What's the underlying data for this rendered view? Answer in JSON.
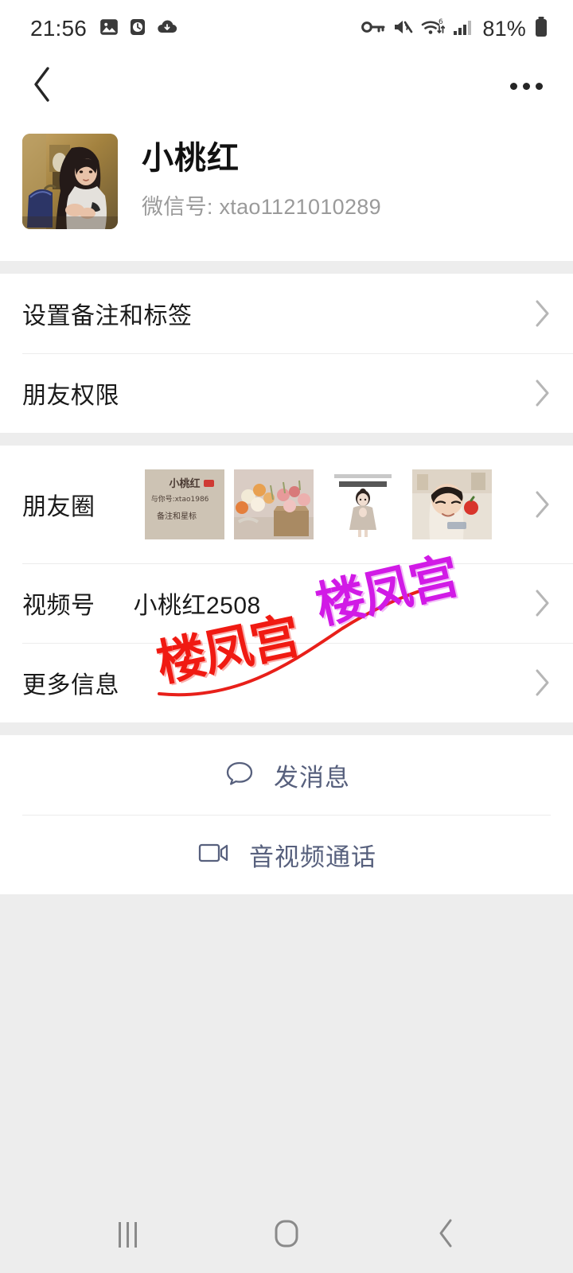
{
  "status_bar": {
    "time": "21:56",
    "battery_percent": "81%",
    "left_icons": [
      "image-icon",
      "clock-icon",
      "cloud-download-icon"
    ],
    "right_icons": [
      "vpn-key-icon",
      "mute-icon",
      "wifi-6-icon",
      "cellular-signal-icon",
      "battery-icon"
    ]
  },
  "nav_bar": {
    "back_icon": "chevron-left-icon",
    "more_icon": "more-options-icon",
    "title": ""
  },
  "profile": {
    "name": "小桃红",
    "wechat_id_label": "微信号:",
    "wechat_id": "xtao1121010289",
    "wechat_id_full": "微信号: xtao1121010289",
    "avatar_alt": "woman-portrait-avatar"
  },
  "settings_rows": [
    {
      "label": "设置备注和标签",
      "chevron": "chevron-right-icon"
    },
    {
      "label": "朋友权限",
      "chevron": "chevron-right-icon"
    }
  ],
  "info_rows": {
    "moments": {
      "label": "朋友圈",
      "chevron": "chevron-right-icon",
      "thumbnails": [
        {
          "alt": "profile-card-thumbnail",
          "caption_name": "小桃红",
          "caption_id": "与你号:xtao1986",
          "caption_note": "备注和星标"
        },
        {
          "alt": "flower-bouquet-thumbnail"
        },
        {
          "alt": "cartoon-girl-thumbnail"
        },
        {
          "alt": "child-with-strawberry-thumbnail"
        }
      ]
    },
    "channels": {
      "label": "视频号",
      "value": "小桃红2508",
      "chevron": "chevron-right-icon"
    },
    "more_info": {
      "label": "更多信息",
      "value": "",
      "chevron": "chevron-right-icon"
    }
  },
  "actions": [
    {
      "label": "发消息",
      "icon": "chat-bubble-icon"
    },
    {
      "label": "音视频通话",
      "icon": "video-camera-icon"
    }
  ],
  "watermark": {
    "red_text": "楼凤宫",
    "magenta_text": "楼凤宫",
    "red_color": "#f01a12",
    "magenta_color": "#d11ae6"
  },
  "system_nav": {
    "recents": "recents-icon",
    "home": "home-icon",
    "back": "back-icon"
  },
  "colors": {
    "page_background": "#ededed",
    "card_background": "#ffffff",
    "primary_text": "#1a1a1a",
    "secondary_text": "#9a9a9a",
    "action_text": "#57607d",
    "divider": "#ececec"
  }
}
